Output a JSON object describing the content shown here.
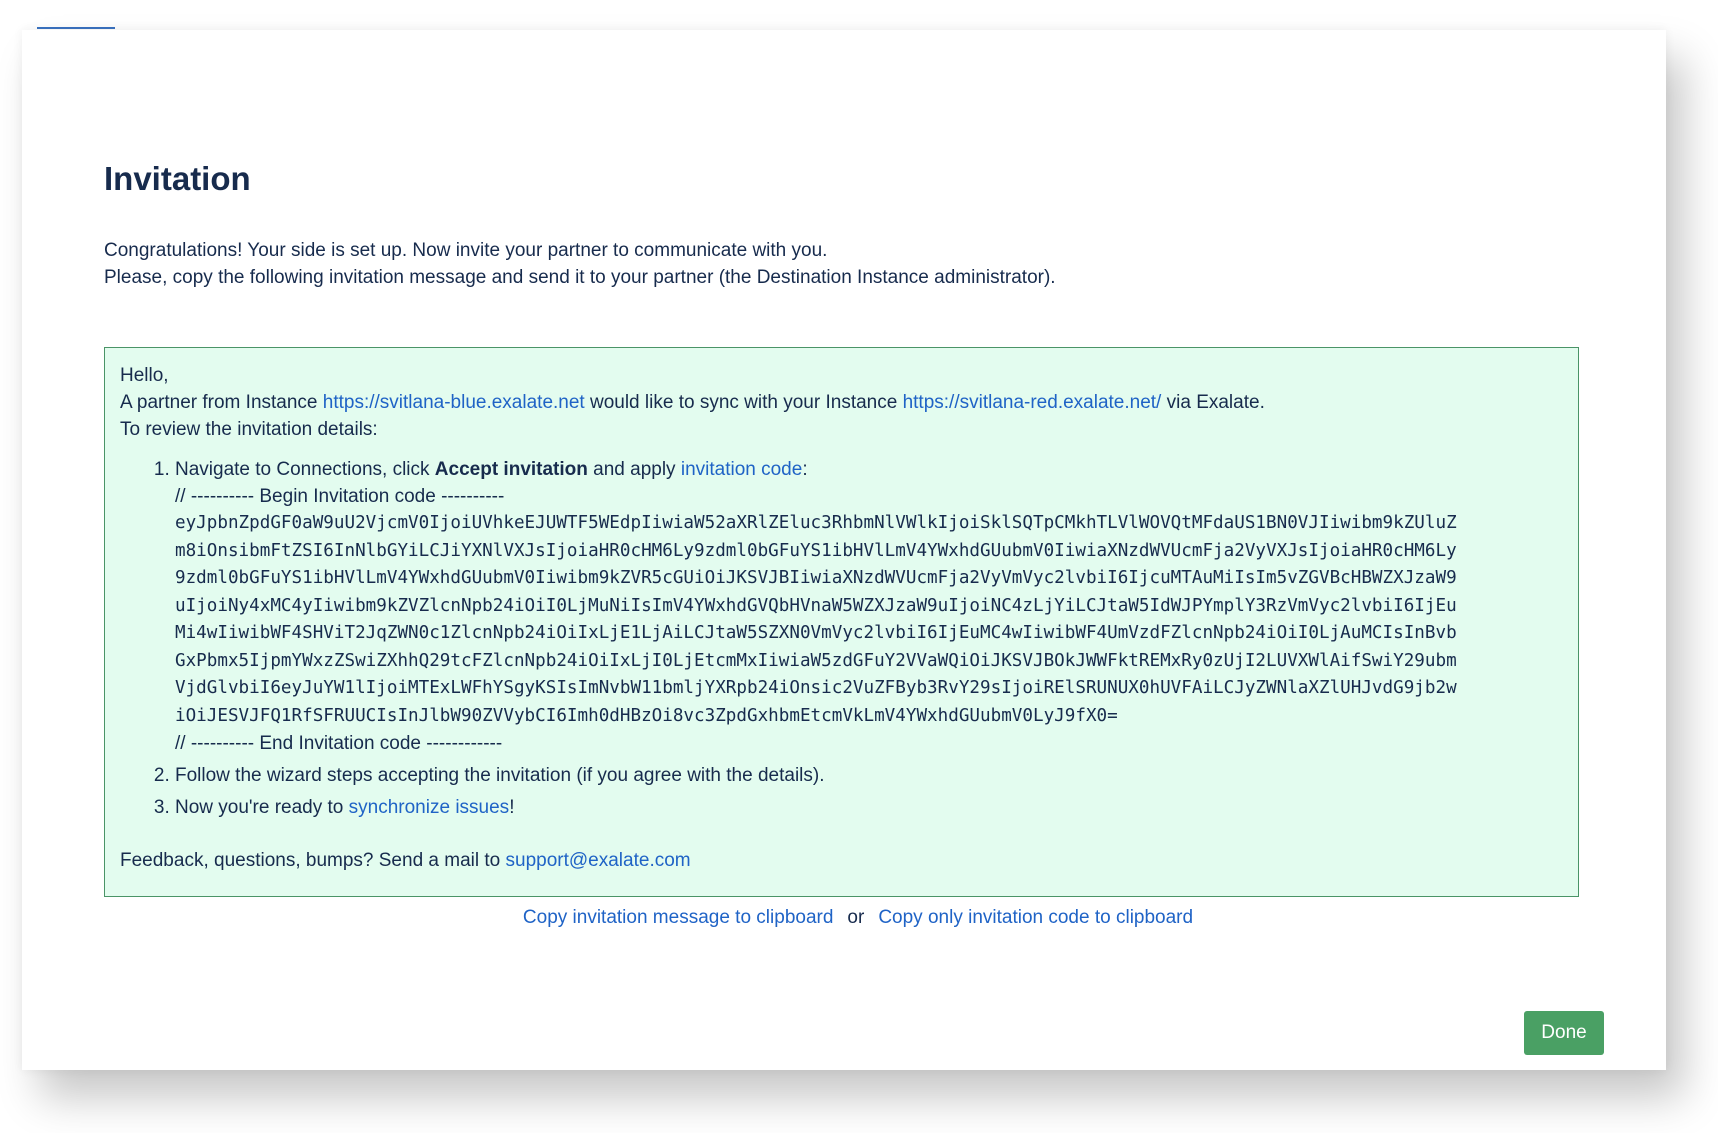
{
  "dialog": {
    "title": "Invitation",
    "intro_line1": "Congratulations! Your side is set up. Now invite your partner to communicate with you.",
    "intro_line2": "Please, copy the following invitation message and send it to your partner (the Destination Instance administrator)."
  },
  "message": {
    "greeting": "Hello,",
    "line_prefix": "A partner from Instance ",
    "source_url": "https://svitlana-blue.exalate.net",
    "line_middle": " would like to sync with your Instance ",
    "destination_url": "https://svitlana-red.exalate.net/",
    "line_suffix": " via Exalate.",
    "review_line": "To review the invitation details:",
    "step1_prefix": "Navigate to Connections, click ",
    "step1_bold": "Accept invitation",
    "step1_middle": " and apply ",
    "step1_link": "invitation code",
    "step1_suffix": ":",
    "code_begin": "// ---------- Begin Invitation code ----------",
    "code_lines": [
      "eyJpbnZpdGF0aW9uU2VjcmV0IjoiUVhkeEJUWTF5WEdpIiwiaW52aXRlZEluc3RhbmNlVWlkIjoiSklSQTpCMkhTLVlWOVQtMFdaUS1BN0VJIiwibm9kZUluZ",
      "m8iOnsibmFtZSI6InNlbGYiLCJiYXNlVXJsIjoiaHR0cHM6Ly9zdml0bGFuYS1ibHVlLmV4YWxhdGUubmV0IiwiaXNzdWVUcmFja2VyVXJsIjoiaHR0cHM6Ly",
      "9zdml0bGFuYS1ibHVlLmV4YWxhdGUubmV0Iiwibm9kZVR5cGUiOiJKSVJBIiwiaXNzdWVUcmFja2VyVmVyc2lvbiI6IjcuMTAuMiIsIm5vZGVBcHBWZXJzaW9",
      "uIjoiNy4xMC4yIiwibm9kZVZlcnNpb24iOiI0LjMuNiIsImV4YWxhdGVQbHVnaW5WZXJzaW9uIjoiNC4zLjYiLCJtaW5IdWJPYmplY3RzVmVyc2lvbiI6IjEu",
      "Mi4wIiwibWF4SHViT2JqZWN0c1ZlcnNpb24iOiIxLjE1LjAiLCJtaW5SZXN0VmVyc2lvbiI6IjEuMC4wIiwibWF4UmVzdFZlcnNpb24iOiI0LjAuMCIsInBvb",
      "GxPbmx5IjpmYWxzZSwiZXhhQ29tcFZlcnNpb24iOiIxLjI0LjEtcmMxIiwiaW5zdGFuY2VVaWQiOiJKSVJBOkJWWFktREMxRy0zUjI2LUVXWlAifSwiY29ubm",
      "VjdGlvbiI6eyJuYW1lIjoiMTExLWFhYSgyKSIsImNvbW11bmljYXRpb24iOnsic2VuZFByb3RvY29sIjoiRElSRUNUX0hUVFAiLCJyZWNlaXZlUHJvdG9jb2w",
      "iOiJESVJFQ1RfSFRUUCIsInJlbW90ZVVybCI6Imh0dHBzOi8vc3ZpdGxhbmEtcmVkLmV4YWxhdGUubmV0LyJ9fX0="
    ],
    "code_end": "// ---------- End Invitation code ------------",
    "step2": "Follow the wizard steps accepting the invitation (if you agree with the details).",
    "step3_prefix": "Now you're ready to ",
    "step3_link": "synchronize issues",
    "step3_suffix": "!",
    "feedback_prefix": "Feedback, questions, bumps? Send a mail to ",
    "support_email": "support@exalate.com"
  },
  "actions": {
    "copy_message": "Copy invitation message to clipboard",
    "or": "or",
    "copy_code": "Copy only invitation code to clipboard",
    "done": "Done"
  },
  "colors": {
    "link": "#1f63c6",
    "box_background": "#e3fcef",
    "box_border": "#4a9467",
    "done_button": "#4aa064",
    "title_text": "#172b4d"
  }
}
